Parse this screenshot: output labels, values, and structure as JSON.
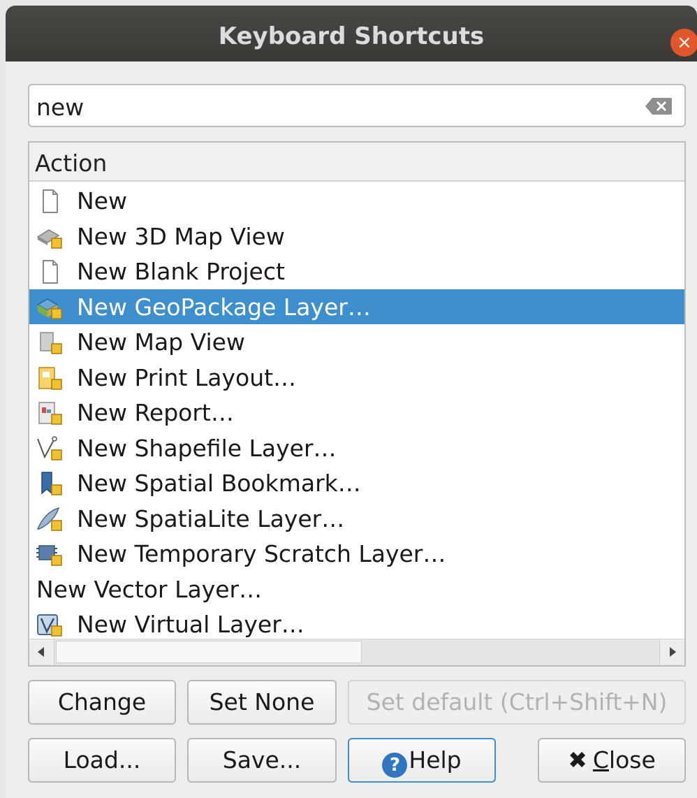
{
  "window": {
    "title": "Keyboard Shortcuts",
    "close_glyph": "×"
  },
  "search": {
    "value": "new"
  },
  "tree": {
    "column_header": "Action",
    "rows": [
      {
        "label": "New",
        "icon": "new-document-icon"
      },
      {
        "label": "New 3D Map View",
        "icon": "new-3d-map-view-icon"
      },
      {
        "label": "New Blank Project",
        "icon": "blank-document-icon"
      },
      {
        "label": "New GeoPackage Layer…",
        "icon": "geopackage-icon",
        "selected": true
      },
      {
        "label": "New Map View",
        "icon": "new-map-view-icon"
      },
      {
        "label": "New Print Layout…",
        "icon": "new-print-layout-icon"
      },
      {
        "label": "New Report…",
        "icon": "new-report-icon"
      },
      {
        "label": "New Shapefile Layer…",
        "icon": "new-shapefile-icon"
      },
      {
        "label": "New Spatial Bookmark…",
        "icon": "new-bookmark-icon"
      },
      {
        "label": "New SpatiaLite Layer…",
        "icon": "new-spatialite-icon"
      },
      {
        "label": "New Temporary Scratch Layer…",
        "icon": "new-memory-layer-icon"
      },
      {
        "label": "New Vector Layer…",
        "icon": ""
      },
      {
        "label": "New Virtual Layer…",
        "icon": "new-virtual-layer-icon"
      }
    ],
    "selected_color": "#3d8fcd"
  },
  "buttons": {
    "change": "Change",
    "set_none": "Set None",
    "set_default": "Set default (Ctrl+Shift+N)",
    "load": "Load...",
    "save": "Save...",
    "help": "Help",
    "help_glyph": "?",
    "close_glyph": "✖",
    "close_mnemonic": "C",
    "close_rest": "lose"
  }
}
